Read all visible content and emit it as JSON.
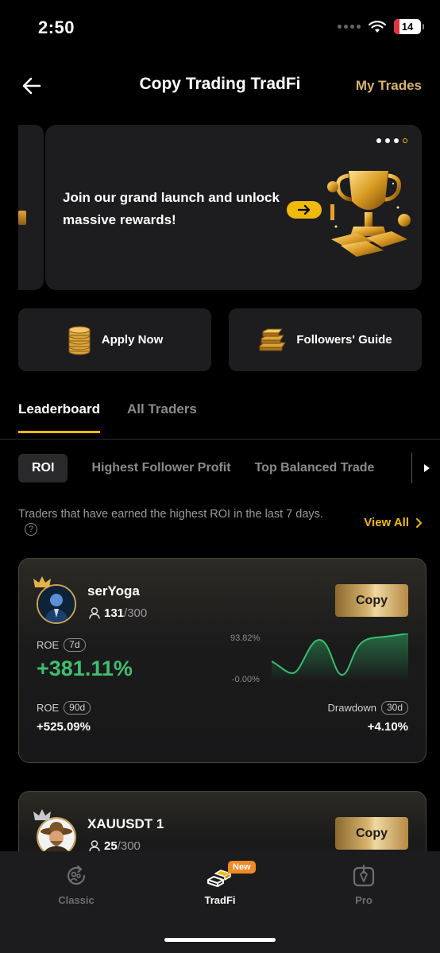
{
  "status_bar": {
    "time": "2:50",
    "battery": "14"
  },
  "header": {
    "title": "Copy Trading TradFi",
    "my_trades": "My Trades"
  },
  "banner": {
    "text": "Join our grand launch and unlock massive rewards!",
    "dot_count": 4,
    "active_dot": 4
  },
  "actions": {
    "apply_now": "Apply Now",
    "followers_guide": "Followers' Guide"
  },
  "tabs": [
    {
      "label": "Leaderboard",
      "active": true
    },
    {
      "label": "All Traders",
      "active": false
    }
  ],
  "filters": [
    {
      "label": "ROI",
      "active": true
    },
    {
      "label": "Highest Follower Profit",
      "active": false
    },
    {
      "label": "Top Balanced Trade",
      "active": false
    }
  ],
  "filter_description": "Traders that have earned the highest ROI in the last 7 days.",
  "view_all": "View All",
  "traders": [
    {
      "name": "serYoga",
      "followers": "131",
      "followers_max": "/300",
      "copy_label": "Copy",
      "roe_label": "ROE",
      "roe_period": "7d",
      "roe_value": "+381.11%",
      "chart_max": "93.82%",
      "chart_min": "-0.00%",
      "roe90_label": "ROE",
      "roe90_period": "90d",
      "roe90_value": "+525.09%",
      "drawdown_label": "Drawdown",
      "drawdown_period": "30d",
      "drawdown_value": "+4.10%"
    },
    {
      "name": "XAUUSDT 1",
      "followers": "25",
      "followers_max": "/300",
      "copy_label": "Copy"
    }
  ],
  "bottom_nav": [
    {
      "label": "Classic",
      "icon": "classic-icon",
      "active": false
    },
    {
      "label": "TradFi",
      "icon": "tradfi-icon",
      "active": true,
      "badge": "New"
    },
    {
      "label": "Pro",
      "icon": "pro-icon",
      "active": false
    }
  ],
  "colors": {
    "accent": "#f0b90b",
    "gold_text": "#d7b46a",
    "profit": "#3fbf6f",
    "background": "#000000"
  }
}
